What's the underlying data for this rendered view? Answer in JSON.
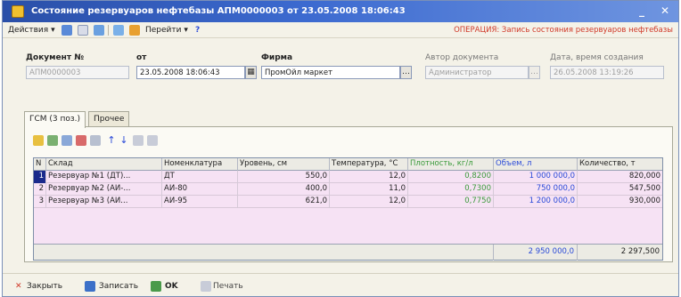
{
  "window": {
    "title": "Состояние резервуаров нефтебазы АПМ0000003 от 23.05.2008 18:06:43",
    "minimize": "_",
    "close": "✕"
  },
  "toolbar": {
    "actions": "Действия",
    "goto": "Перейти",
    "help": "?",
    "operation": "ОПЕРАЦИЯ: Запись состояния резервуаров нефтебазы"
  },
  "header": {
    "doc_label": "Документ №",
    "doc_value": "АПМ0000003",
    "date_label": "от",
    "date_value": "23.05.2008 18:06:43",
    "firm_label": "Фирма",
    "firm_value": "ПромОйл маркет",
    "author_label": "Автор документа",
    "author_value": "Администратор",
    "created_label": "Дата, время создания",
    "created_value": "26.05.2008 13:19:26"
  },
  "tabs": [
    "ГСМ (3 поз.)",
    "Прочее"
  ],
  "grid": {
    "columns": [
      "N",
      "Склад",
      "Номенклатура",
      "Уровень, см",
      "Температура, °С",
      "Плотность, кг/л",
      "Объем, л",
      "Количество, т"
    ],
    "rows": [
      [
        "1",
        "Резервуар №1 (ДТ)...",
        "ДТ",
        "550,0",
        "12,0",
        "0,8200",
        "1 000 000,0",
        "820,000"
      ],
      [
        "2",
        "Резервуар №2 (АИ-...",
        "АИ-80",
        "400,0",
        "11,0",
        "0,7300",
        "750 000,0",
        "547,500"
      ],
      [
        "3",
        "Резервуар №3 (АИ...",
        "АИ-95",
        "621,0",
        "12,0",
        "0,7750",
        "1 200 000,0",
        "930,000"
      ]
    ],
    "totals": {
      "volume": "2 950 000,0",
      "quantity": "2 297,500"
    }
  },
  "bottom": {
    "close": "Закрыть",
    "save": "Записать",
    "ok": "OK",
    "print": "Печать"
  },
  "colors": {
    "title_bar": "#3c6ad0",
    "row_bg": "#f6e2f4",
    "selected_row": "#1a2a8c",
    "operation_text": "#d03a2a",
    "density_col": "#3a9a3a",
    "volume_col": "#2a4ad8"
  }
}
